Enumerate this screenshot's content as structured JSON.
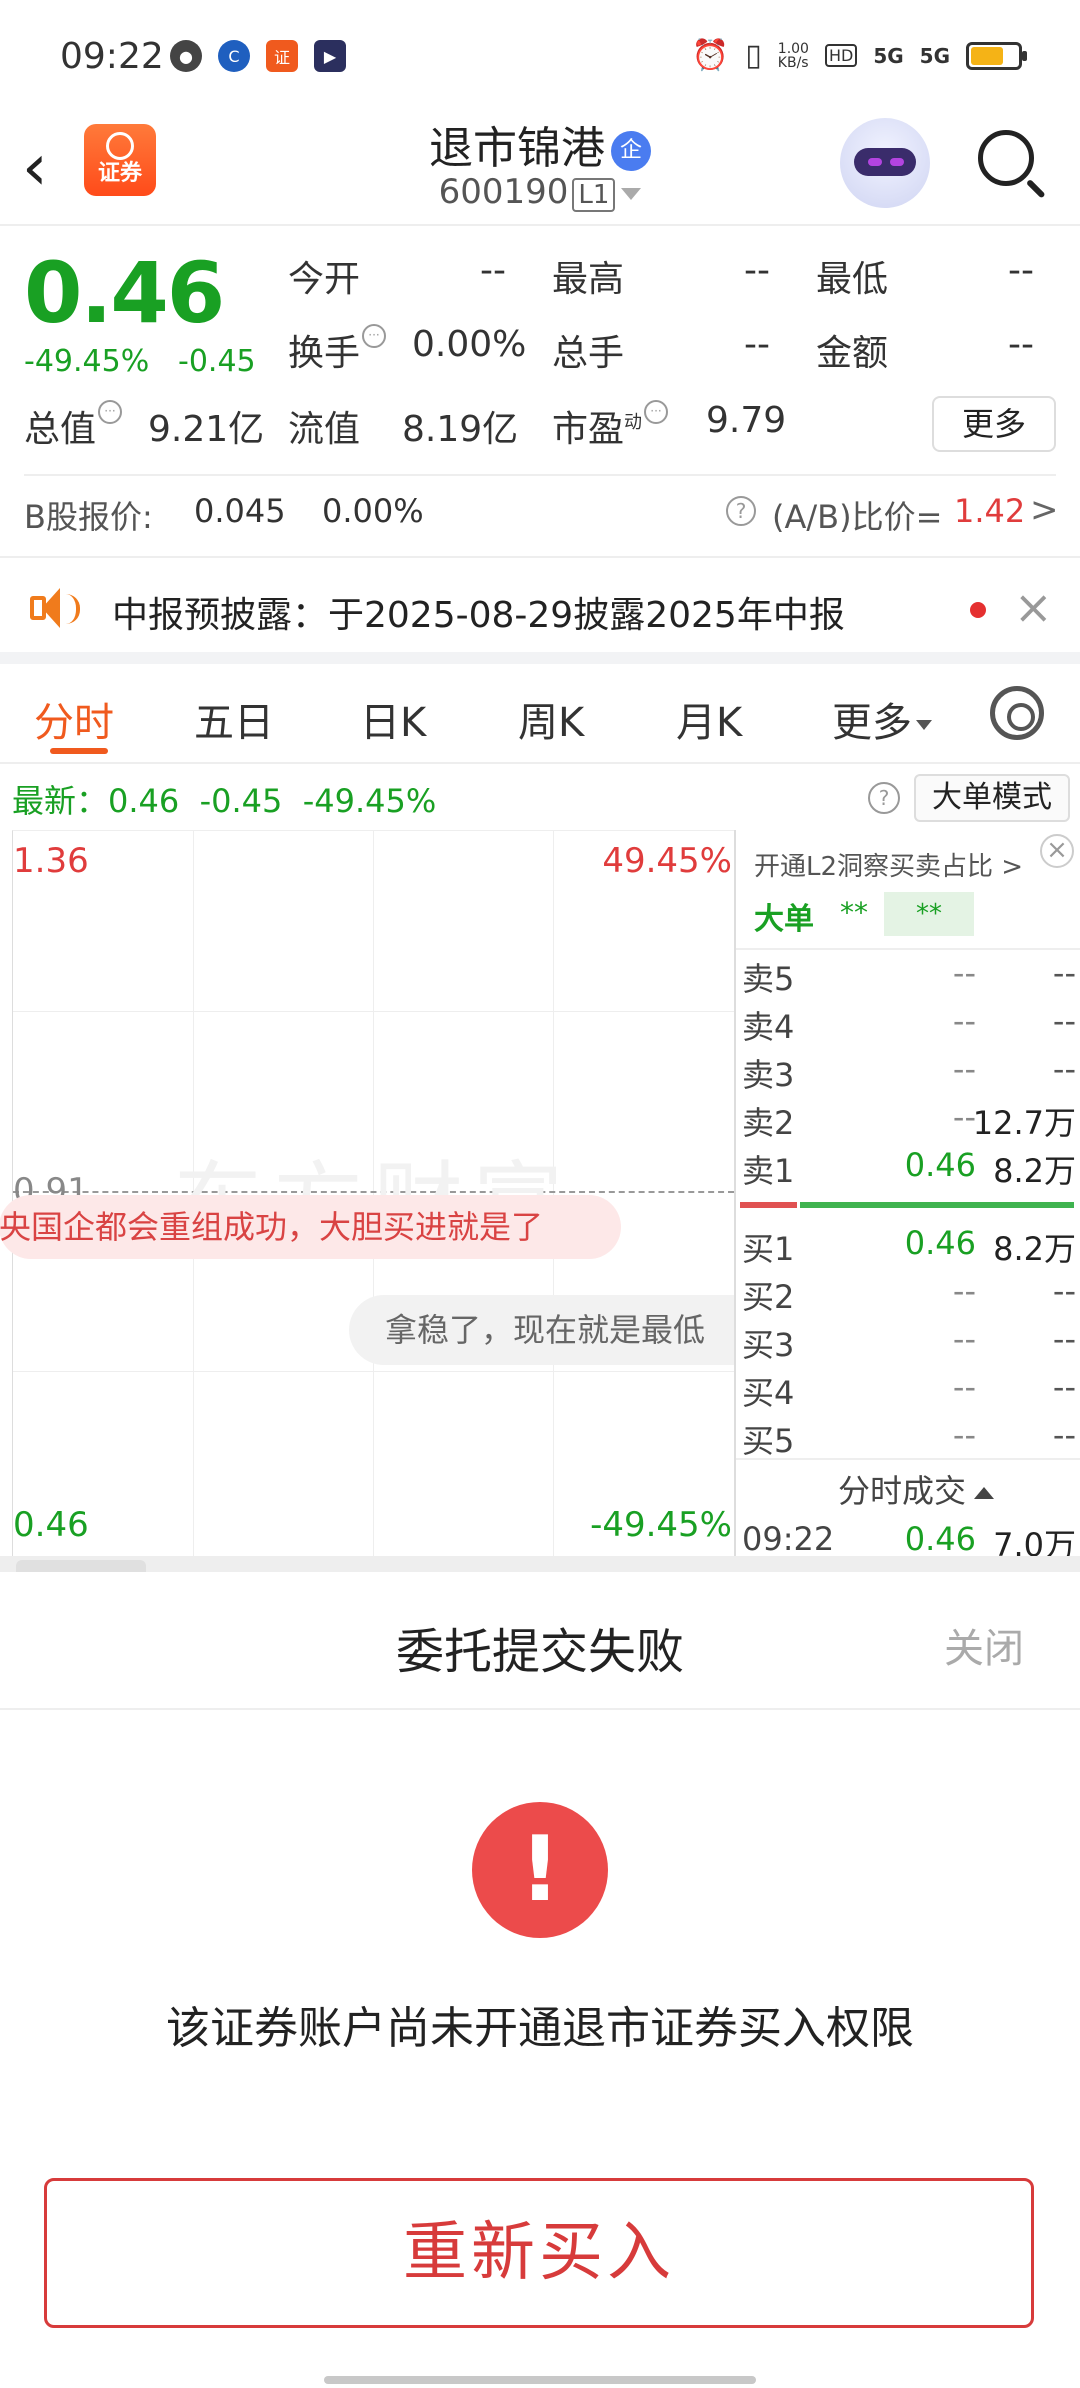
{
  "status_bar": {
    "time": "09:22",
    "net_speed": "1.00\nKB/s",
    "hd": "HD",
    "signal1": "5G",
    "signal2": "5G",
    "battery_level_pct": 70
  },
  "header": {
    "back_icon": "chevron-left-icon",
    "app_logo_text": "证券",
    "stock_name": "退市锦港",
    "enterprise_badge": "企",
    "stock_code": "600190",
    "level": "L1"
  },
  "quote": {
    "price": "0.46",
    "pct": "-49.45%",
    "change": "-0.45",
    "fields": {
      "open_label": "今开",
      "open_value": "--",
      "high_label": "最高",
      "high_value": "--",
      "low_label": "最低",
      "low_value": "--",
      "turnover_label": "换手",
      "turnover_value": "0.00%",
      "volume_label": "总手",
      "volume_value": "--",
      "amount_label": "金额",
      "amount_value": "--",
      "mktcap_label": "总值",
      "mktcap_value": "9.21亿",
      "float_label": "流值",
      "float_value": "8.19亿",
      "pe_label": "市盈",
      "pe_sup": "动",
      "pe_value": "9.79"
    },
    "more_label": "更多",
    "b_share_label": "B股报价:",
    "b_share_price": "0.045",
    "b_share_pct": "0.00%",
    "ab_ratio_label": "(A/B)比价=",
    "ab_ratio_value": "1.42",
    "ab_arrow": ">"
  },
  "notice": {
    "text": "中报预披露：于2025-08-29披露2025年中报",
    "close": "×"
  },
  "tabs": [
    {
      "label": "分时",
      "active": true
    },
    {
      "label": "五日"
    },
    {
      "label": "日K"
    },
    {
      "label": "周K"
    },
    {
      "label": "月K"
    },
    {
      "label": "更多"
    }
  ],
  "latest_line": {
    "text": "最新：0.46  -0.45  -49.45%",
    "help": "?",
    "mode_button": "大单模式"
  },
  "chart": {
    "y_top": "1.36",
    "y_top_pct": "49.45%",
    "y_mid": "0.91",
    "y_bottom": "0.46",
    "y_bottom_pct": "-49.45%",
    "watermark": "东方财富",
    "comment1": "央国企都会重组成功，大胆买进就是了",
    "comment2": "拿稳了，现在就是最低"
  },
  "order_book": {
    "l2_link": "开通L2洞察买卖占比 >",
    "close": "×",
    "big_label": "大单",
    "big_value1": "**",
    "big_value2": "**",
    "sells": [
      {
        "label": "卖5",
        "price": "--",
        "vol": "--"
      },
      {
        "label": "卖4",
        "price": "--",
        "vol": "--"
      },
      {
        "label": "卖3",
        "price": "--",
        "vol": "--"
      },
      {
        "label": "卖2",
        "price": "--",
        "vol": "12.7万"
      },
      {
        "label": "卖1",
        "price": "0.46",
        "vol": "8.2万"
      }
    ],
    "buys": [
      {
        "label": "买1",
        "price": "0.46",
        "vol": "8.2万"
      },
      {
        "label": "买2",
        "price": "--",
        "vol": "--"
      },
      {
        "label": "买3",
        "price": "--",
        "vol": "--"
      },
      {
        "label": "买4",
        "price": "--",
        "vol": "--"
      },
      {
        "label": "买5",
        "price": "--",
        "vol": "--"
      }
    ],
    "sell_ratio_pct": 17,
    "ticks_title": "分时成交",
    "tick": {
      "time": "09:22",
      "price": "0.46",
      "vol": "7.0万"
    }
  },
  "modal": {
    "title": "委托提交失败",
    "close": "关闭",
    "alert_icon": "exclamation-icon",
    "alert_mark": "!",
    "message": "该证券账户尚未开通退市证券买入权限",
    "rebuy_button": "重新买入"
  },
  "colors": {
    "down": "#19a023",
    "up": "#e03c3c",
    "accent": "#f05a1e",
    "alert": "#ec4b4b"
  }
}
